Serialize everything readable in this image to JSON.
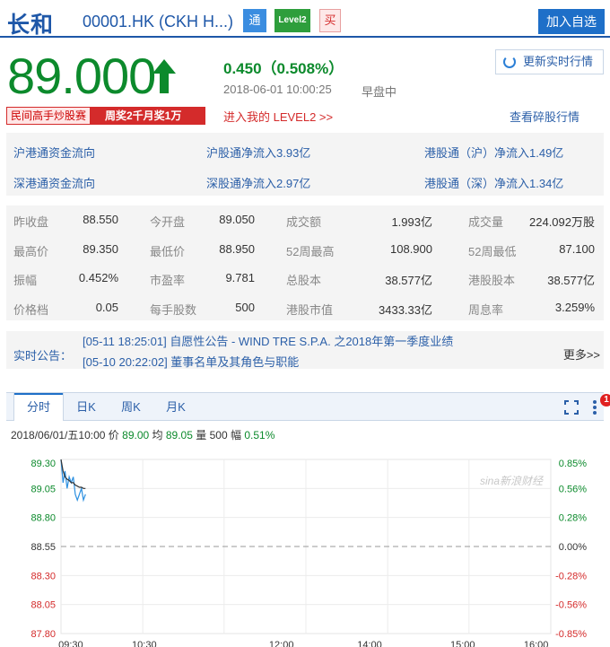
{
  "header": {
    "stock_name": "长和",
    "code": "00001.HK (CKH H...)",
    "tag_tong": "通",
    "tag_level2": "Level2",
    "tag_buy": "买",
    "add_watch": "加入自选"
  },
  "quote": {
    "price": "89.000",
    "change": "0.450（0.508%）",
    "timestamp": "2018-06-01 10:00:25",
    "status": "早盘中",
    "refresh_label": "更新实时行情"
  },
  "promo": {
    "part1": "民间高手炒股赛",
    "part2": "周奖2千月奖1万",
    "level2_link": "进入我的 LEVEL2 >>",
    "broken_lot_link": "查看碎股行情"
  },
  "flows": {
    "sh_hk_title": "沪港通资金流向",
    "sh_hk_in": "沪股通净流入3.93亿",
    "hk_sh_in": "港股通（沪）净流入1.49亿",
    "sz_hk_title": "深港通资金流向",
    "sz_hk_in": "深股通净流入2.97亿",
    "hk_sz_in": "港股通（深）净流入1.34亿"
  },
  "stats": [
    [
      [
        "昨收盘",
        "88.550"
      ],
      [
        "今开盘",
        "89.050"
      ],
      [
        "成交额",
        "1.993亿"
      ],
      [
        "成交量",
        "224.092万股"
      ]
    ],
    [
      [
        "最高价",
        "89.350"
      ],
      [
        "最低价",
        "88.950"
      ],
      [
        "52周最高",
        "108.900"
      ],
      [
        "52周最低",
        "87.100"
      ]
    ],
    [
      [
        "振幅",
        "0.452%"
      ],
      [
        "市盈率",
        "9.781"
      ],
      [
        "总股本",
        "38.577亿"
      ],
      [
        "港股股本",
        "38.577亿"
      ]
    ],
    [
      [
        "价格档",
        "0.05"
      ],
      [
        "每手股数",
        "500"
      ],
      [
        "港股市值",
        "3433.33亿"
      ],
      [
        "周息率",
        "3.259%"
      ]
    ]
  ],
  "announcements": {
    "label": "实时公告：",
    "line1": "[05-11 18:25:01] 自愿性公告 - WIND TRE S.P.A. 之2018年第一季度业绩",
    "line2": "[05-10 20:22:02] 董事名单及其角色与职能",
    "more": "更多>>"
  },
  "chart_tabs": [
    "分时",
    "日K",
    "周K",
    "月K"
  ],
  "badge_count": "1",
  "chart_info": {
    "date": "2018/06/01/五10:00",
    "price_label": "价",
    "price": "89.00",
    "avg_label": "均",
    "avg": "89.05",
    "vol_label": "量",
    "vol": "500",
    "amp_label": "幅",
    "amp": "0.51%"
  },
  "watermark": "sina新浪财经",
  "chart_data": {
    "type": "line",
    "y_left_ticks": [
      "89.30",
      "89.05",
      "88.80",
      "88.55",
      "88.30",
      "88.05",
      "87.80"
    ],
    "y_right_ticks": [
      "0.85%",
      "0.56%",
      "0.28%",
      "0.00%",
      "-0.28%",
      "-0.56%",
      "-0.85%"
    ],
    "x_ticks": [
      "09:30",
      "10:30",
      "12:00",
      "14:00",
      "15:00",
      "16:00"
    ],
    "ylim": [
      87.8,
      89.3
    ],
    "baseline": 88.55,
    "series": [
      {
        "values": [
          89.3,
          89.1,
          89.2,
          89.05,
          89.15,
          89.1,
          89.15,
          89.0,
          88.95,
          89.0,
          89.05,
          88.95,
          89.0
        ]
      },
      {
        "values": [
          89.3,
          89.2,
          89.15,
          89.13,
          89.12,
          89.1,
          89.1,
          89.08,
          89.07,
          89.06,
          89.06,
          89.05,
          89.05
        ]
      }
    ],
    "colors": {
      "price": "#2b8fe0",
      "avg": "#333333",
      "up": "#0c8a2c",
      "down": "#d42b2b"
    }
  }
}
